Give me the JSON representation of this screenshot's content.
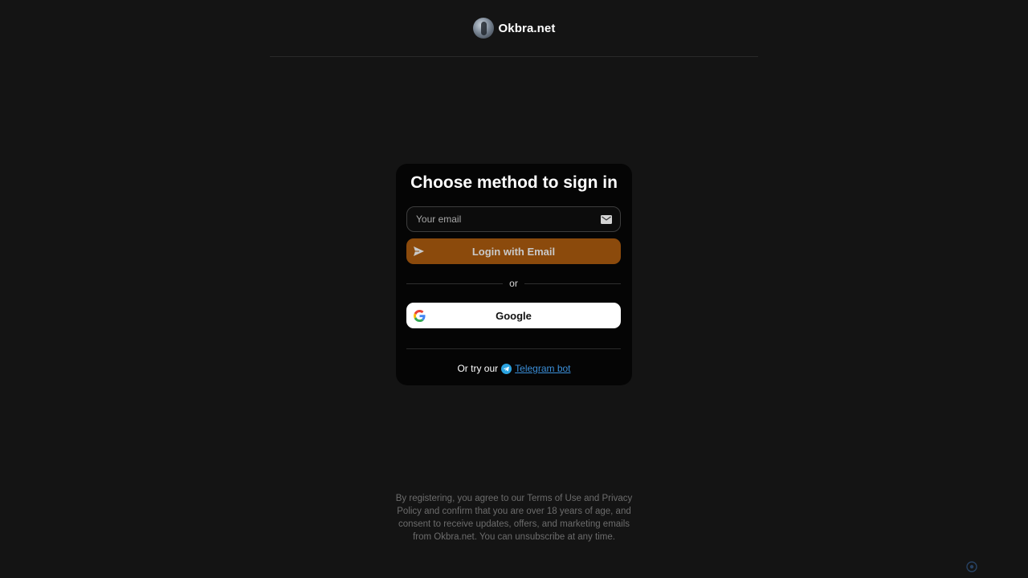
{
  "header": {
    "site_name": "Okbra.net"
  },
  "card": {
    "title": "Choose method to sign in",
    "email_placeholder": "Your email",
    "login_button_label": "Login with Email",
    "divider_text": "or",
    "google_button_label": "Google",
    "telegram_prefix": "Or try our",
    "telegram_link_text": "Telegram bot"
  },
  "footer": {
    "disclaimer": "By registering, you agree to our Terms of Use and Privacy Policy and confirm that you are over 18 years of age, and consent to receive updates, offers, and marketing emails from Okbra.net. You can unsubscribe at any time."
  },
  "colors": {
    "background": "#141414",
    "card": "#050505",
    "login_button": "#8b4a0c",
    "link": "#3b8fd9"
  },
  "icons": {
    "logo": "avatar-logo-icon",
    "email": "mail-icon",
    "send": "send-arrow-icon",
    "google": "google-g-icon",
    "telegram": "telegram-icon"
  }
}
